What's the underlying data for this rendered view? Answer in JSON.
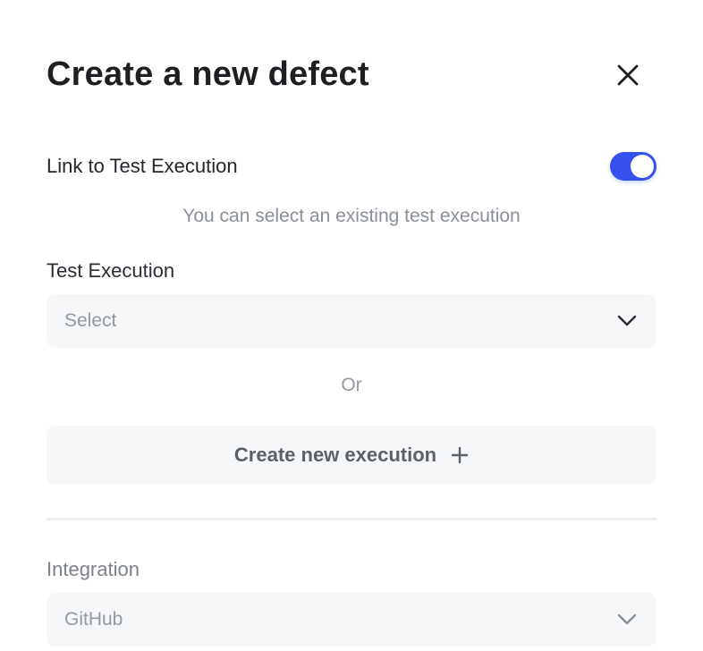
{
  "dialog": {
    "title": "Create a new defect"
  },
  "link_test_execution": {
    "label": "Link to Test Execution",
    "enabled": true,
    "hint": "You can select an existing test execution"
  },
  "test_execution": {
    "label": "Test Execution",
    "value": "Select"
  },
  "separator_text": "Or",
  "create_execution": {
    "label": "Create new execution"
  },
  "integration": {
    "label": "Integration",
    "value": "GitHub"
  },
  "colors": {
    "accent": "#3451f0",
    "field_bg": "#f6f7f9",
    "muted_text": "#9499a1"
  },
  "icons": {
    "close": "close-icon",
    "chevron": "chevron-down-icon",
    "plus": "plus-icon"
  }
}
